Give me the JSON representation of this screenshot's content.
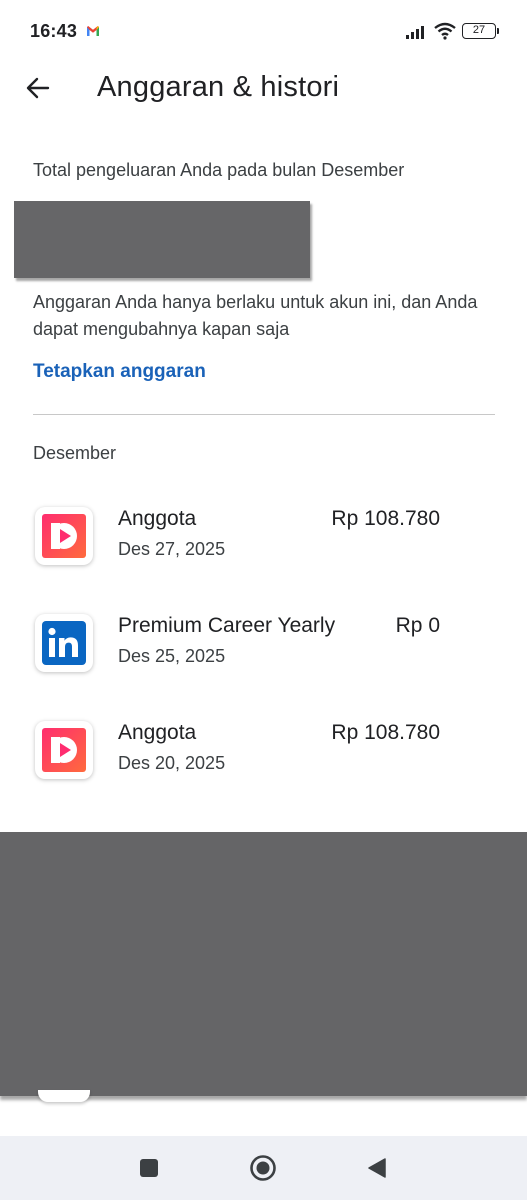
{
  "status_bar": {
    "time": "16:43",
    "battery": "27",
    "notification_icon": "gmail-icon"
  },
  "app_bar": {
    "back_icon": "arrow-left-icon",
    "title": "Anggaran & histori"
  },
  "summary": {
    "label": "Total pengeluaran Anda pada bulan Desember",
    "note": "Anggaran Anda hanya berlaku untuk akun ini, dan Anda dapat mengubahnya kapan saja",
    "set_budget_link": "Tetapkan anggaran"
  },
  "history": {
    "month": "Desember",
    "transactions": [
      {
        "name": "Anggota",
        "date": "Des 27, 2025",
        "amount": "Rp 108.780",
        "icon": "play-app-icon"
      },
      {
        "name": "Premium Career Yearly",
        "date": "Des 25, 2025",
        "amount": "Rp 0",
        "icon": "linkedin-icon"
      },
      {
        "name": "Anggota",
        "date": "Des 20, 2025",
        "amount": "Rp 108.780",
        "icon": "play-app-icon"
      }
    ]
  },
  "colors": {
    "link": "#1a62b8",
    "redaction": "#666668",
    "play_icon_gradient_start": "#ff3e6b",
    "play_icon_gradient_end": "#ff8a3d",
    "linkedin_blue": "#0a66c2",
    "navbar_bg": "#eef0f5"
  },
  "nav_bar": {
    "recents_icon": "square-icon",
    "home_icon": "circle-home-icon",
    "back_icon": "triangle-back-icon"
  }
}
